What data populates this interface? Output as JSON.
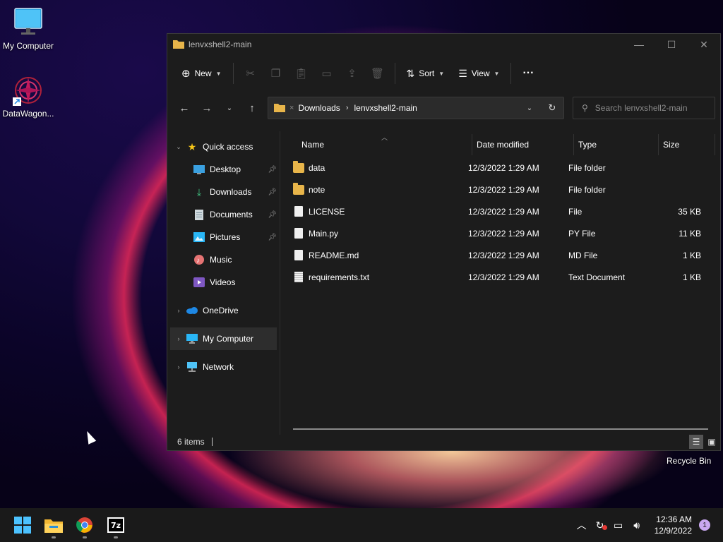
{
  "desktop": {
    "icons": [
      {
        "label": "My Computer",
        "icon": "monitor-icon"
      },
      {
        "label": "DataWagon...",
        "icon": "datawagon-icon"
      }
    ],
    "recycle_bin_label": "Recycle Bin"
  },
  "window": {
    "title": "lenvxshell2-main",
    "toolbar": {
      "new_label": "New",
      "sort_label": "Sort",
      "view_label": "View",
      "more_label": "···"
    },
    "address": {
      "crumbs": [
        "Downloads",
        "lenvxshell2-main"
      ]
    },
    "search": {
      "placeholder": "Search lenvxshell2-main"
    },
    "navpane": {
      "quick_access": "Quick access",
      "items": [
        "Desktop",
        "Downloads",
        "Documents",
        "Pictures",
        "Music",
        "Videos"
      ],
      "onedrive": "OneDrive",
      "my_computer": "My Computer",
      "network": "Network"
    },
    "columns": {
      "name": "Name",
      "date": "Date modified",
      "type": "Type",
      "size": "Size"
    },
    "files": [
      {
        "name": "data",
        "date": "12/3/2022 1:29 AM",
        "type": "File folder",
        "size": "",
        "kind": "folder"
      },
      {
        "name": "note",
        "date": "12/3/2022 1:29 AM",
        "type": "File folder",
        "size": "",
        "kind": "folder"
      },
      {
        "name": "LICENSE",
        "date": "12/3/2022 1:29 AM",
        "type": "File",
        "size": "35 KB",
        "kind": "doc"
      },
      {
        "name": "Main.py",
        "date": "12/3/2022 1:29 AM",
        "type": "PY File",
        "size": "11 KB",
        "kind": "doc"
      },
      {
        "name": "README.md",
        "date": "12/3/2022 1:29 AM",
        "type": "MD File",
        "size": "1 KB",
        "kind": "doc"
      },
      {
        "name": "requirements.txt",
        "date": "12/3/2022 1:29 AM",
        "type": "Text Document",
        "size": "1 KB",
        "kind": "txt"
      }
    ],
    "status": "6 items"
  },
  "taskbar": {
    "clock_time": "12:36 AM",
    "clock_date": "12/9/2022",
    "notification_count": "1",
    "seven_zip_label": "7z"
  },
  "colors": {
    "accent": "#4cc2ff",
    "folder": "#e8b54a",
    "window_bg": "#1c1c1c"
  }
}
